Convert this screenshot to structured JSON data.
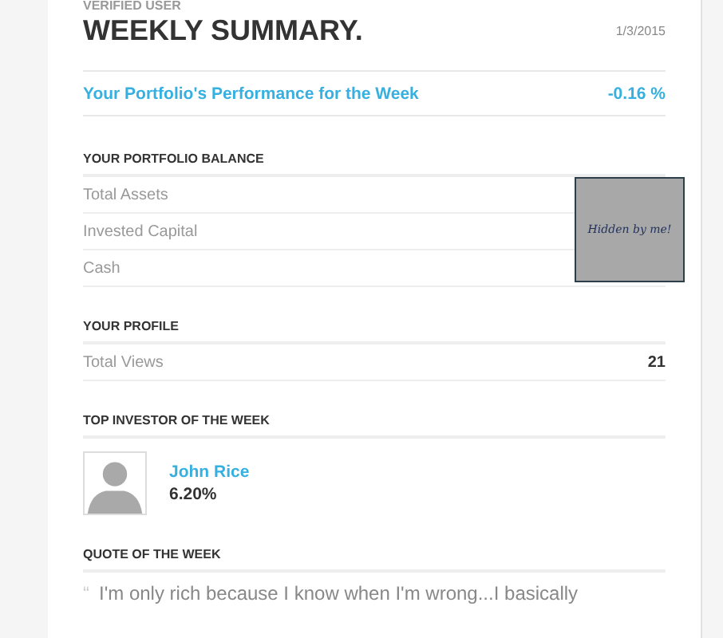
{
  "header": {
    "eyebrow": "VERIFIED USER",
    "title": "WEEKLY SUMMARY.",
    "date": "1/3/2015"
  },
  "performance": {
    "label": "Your Portfolio's Performance for the Week",
    "value": "-0.16 %"
  },
  "balance": {
    "heading": "YOUR PORTFOLIO BALANCE",
    "rows": [
      {
        "label": "Total Assets"
      },
      {
        "label": "Invested Capital"
      },
      {
        "label": "Cash"
      }
    ],
    "redaction": "Hidden by me!"
  },
  "profile": {
    "heading": "YOUR PROFILE",
    "rows": [
      {
        "label": "Total Views",
        "value": "21"
      }
    ]
  },
  "top_investor": {
    "heading": "TOP INVESTOR OF THE WEEK",
    "name": "John Rice",
    "return": "6.20%"
  },
  "quote": {
    "heading": "QUOTE OF THE WEEK",
    "mark": "“",
    "text": "I'm only rich because I know when I'm wrong...I basically"
  }
}
